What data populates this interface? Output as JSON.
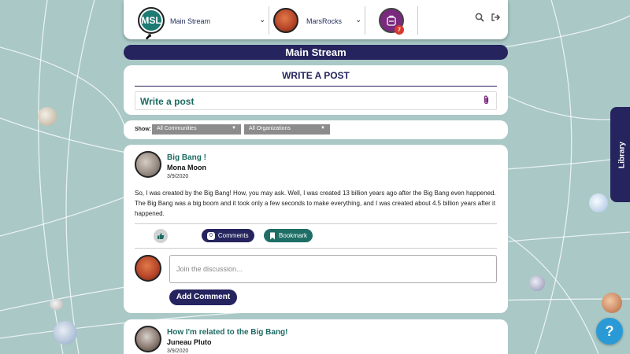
{
  "nav": {
    "stream_avatar_text": "MSL",
    "stream_label": "Main Stream",
    "community_label": "MarsRocks",
    "backpack_badge": "7"
  },
  "title_bar": "Main Stream",
  "write_post": {
    "heading": "WRITE A POST",
    "placeholder": "Write a post"
  },
  "filters": {
    "show_label": "Show:",
    "communities": "All Communities",
    "organizations": "All Organizations"
  },
  "posts": [
    {
      "title": "Big Bang !",
      "author": "Mona Moon",
      "date": "3/9/2020",
      "body": "So, I was created by the Big Bang! How, you may ask. Well, I was created 13 billion years ago after the Big Bang even happened. The Big Bang was a big boom and it took only a few seconds to make everything, and I was created about 4.5 billion years after it happened.",
      "comments_count": "0",
      "comments_label": "Comments",
      "bookmark_label": "Bookmark",
      "discussion_placeholder": "Join the discussion...",
      "add_comment_label": "Add Comment"
    },
    {
      "title": "How I'm related to the Big Bang!",
      "author": "Juneau Pluto",
      "date": "3/9/2020"
    }
  ],
  "library_label": "Library",
  "help_label": "?",
  "icons": [
    "search-icon",
    "logout-icon",
    "chevron-down-icon",
    "backpack-icon",
    "paperclip-icon",
    "thumbs-up-icon",
    "bookmark-icon",
    "help-icon"
  ],
  "colors": {
    "navy": "#25245e",
    "teal": "#1e6e66",
    "background": "#a9c8c6",
    "purple": "#7a2a7e"
  }
}
